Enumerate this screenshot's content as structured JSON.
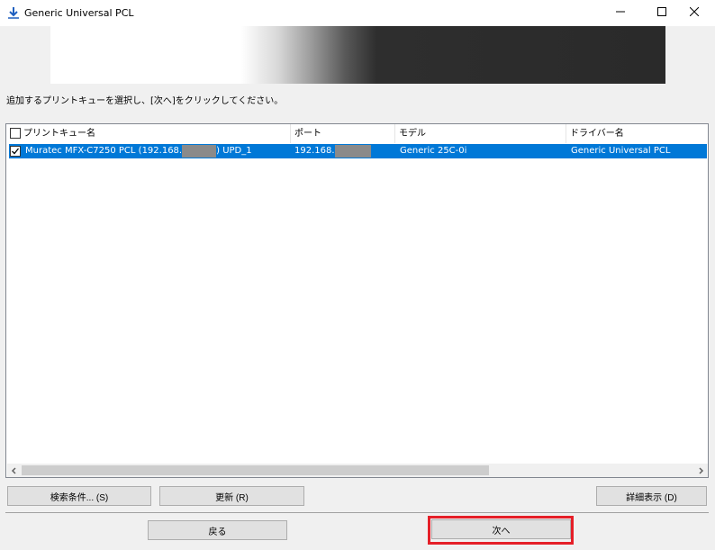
{
  "window": {
    "title": "Generic Universal PCL",
    "icon": "download-arrow-icon"
  },
  "instruction": "追加するプリントキューを選択し、[次へ]をクリックしてください。",
  "list": {
    "headers": [
      "プリントキュー名",
      "ポート",
      "モデル",
      "ドライバー名"
    ],
    "rows": [
      {
        "checked": true,
        "queue_prefix": "Muratec MFX-C7250 PCL (192.168.",
        "queue_suffix": ") UPD_1",
        "port_prefix": "192.168.",
        "model": "Generic 25C-0i",
        "driver": "Generic Universal PCL"
      }
    ]
  },
  "buttons": {
    "search": "検索条件... (S)",
    "refresh": "更新 (R)",
    "detail": "詳細表示 (D)",
    "back": "戻る",
    "next": "次へ"
  },
  "colors": {
    "selection": "#0078d7",
    "highlight": "#e51f28"
  }
}
